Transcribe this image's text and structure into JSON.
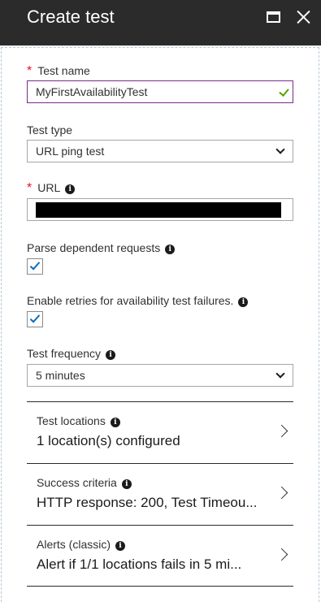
{
  "header": {
    "title": "Create test"
  },
  "form": {
    "test_name": {
      "label": "Test name",
      "required": "*",
      "value": "MyFirstAvailabilityTest"
    },
    "test_type": {
      "label": "Test type",
      "value": "URL ping test"
    },
    "url": {
      "label": "URL",
      "required": "*",
      "value": ""
    },
    "parse_dependent": {
      "label": "Parse dependent requests",
      "checked": true
    },
    "enable_retries": {
      "label": "Enable retries for availability test failures.",
      "checked": true
    },
    "test_frequency": {
      "label": "Test frequency",
      "value": "5 minutes"
    }
  },
  "sections": [
    {
      "label": "Test locations",
      "value": "1 location(s) configured"
    },
    {
      "label": "Success criteria",
      "value": "HTTP response: 200, Test Timeou..."
    },
    {
      "label": "Alerts (classic)",
      "value": "Alert if 1/1 locations fails in 5 mi..."
    }
  ],
  "colors": {
    "header_bg": "#2b2b2b",
    "required": "#e81123",
    "valid_check": "#57a300",
    "checkbox_tick": "#0b6cbd",
    "active_border": "#7a2a8a"
  },
  "icons": {
    "info": "info-icon",
    "maximize": "maximize-icon",
    "close": "close-icon",
    "chevron": "chevron-down-icon",
    "nav": "chevron-right-icon"
  }
}
